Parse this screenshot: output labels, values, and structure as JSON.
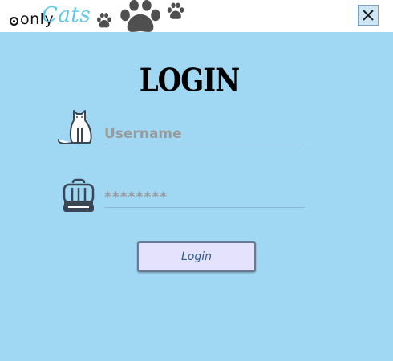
{
  "titlebar": {
    "logo": {
      "prefix": "only",
      "brand": "Cats"
    },
    "close_glyph": "✕",
    "icons": [
      "paw-small-icon",
      "paw-large-icon",
      "paw-right-icon",
      "close-icon"
    ]
  },
  "login": {
    "heading": "LOGIN",
    "username_placeholder": "Username",
    "password_value": "********",
    "button_label": "Login",
    "icons": [
      "cat-icon",
      "pet-carrier-icon"
    ]
  },
  "colors": {
    "background": "#a0d8f4",
    "titlebar": "#ffffff",
    "brand_accent": "#5fc8e8",
    "button_fill": "#e4e2fd",
    "button_text": "#2d5c8c"
  }
}
